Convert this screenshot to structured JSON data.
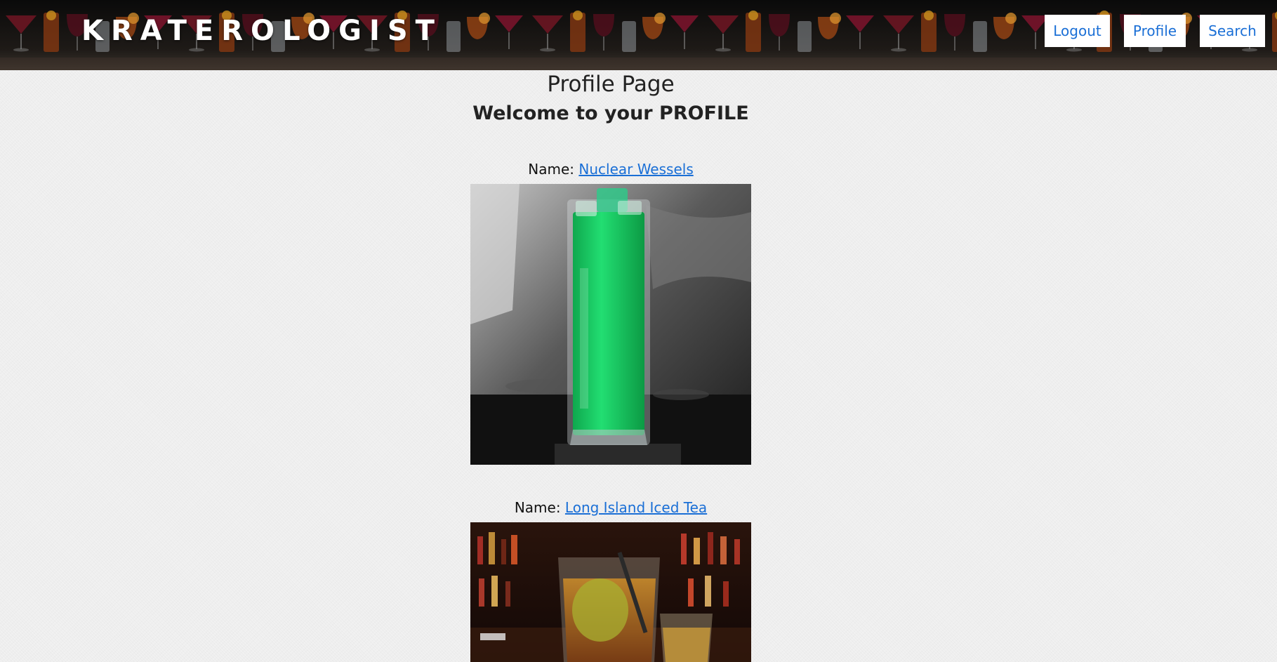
{
  "header": {
    "brand": "KRATEROLOGIST",
    "nav": {
      "logout_label": "Logout",
      "profile_label": "Profile",
      "search_label": "Search"
    }
  },
  "main": {
    "title": "Profile Page",
    "welcome": "Welcome to your PROFILE",
    "drinks": [
      {
        "label": "Name:",
        "name": "Nuclear Wessels"
      },
      {
        "label": "Name:",
        "name": "Long Island Iced Tea"
      }
    ]
  },
  "colors": {
    "link": "#1a6fd6",
    "background": "#f1f1f1",
    "header_bg": "#141210",
    "drink1_accent": "#1ed86a",
    "drink2_accent": "#c88a2a"
  }
}
